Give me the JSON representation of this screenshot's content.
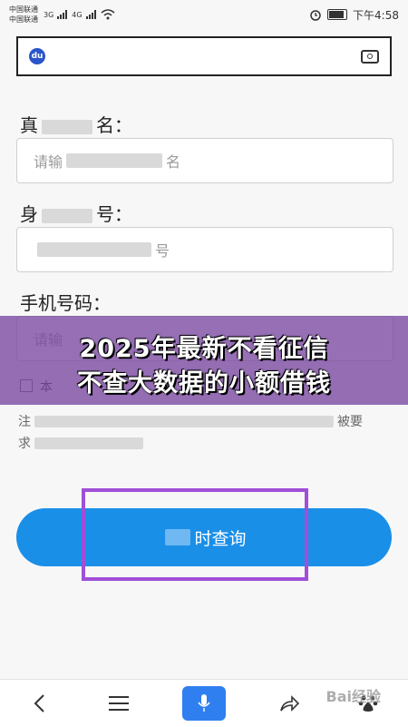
{
  "status_bar": {
    "carrier1": "中国联通",
    "carrier2": "中国联通",
    "sig1": "3G",
    "sig2": "4G",
    "time": "下午4:58"
  },
  "search": {
    "logo": "du"
  },
  "form": {
    "name_label_a": "真",
    "name_label_b": "名：",
    "name_placeholder_a": "请输",
    "name_placeholder_b": "名",
    "id_label_a": "身",
    "id_label_b": "号：",
    "id_placeholder_b": "号",
    "phone_label": "手机号码：",
    "phone_placeholder_a": "请输",
    "agree_a": "本",
    "note_a": "注",
    "note_b": "被要",
    "note_c": "求"
  },
  "overlay": {
    "line1": "2025年最新不看征信",
    "line2": "不查大数据的小额借钱"
  },
  "submit": {
    "label": "查询",
    "label_prefix": "时"
  },
  "watermark": "Bai经验",
  "icons": {
    "search_logo": "baidu-paw-icon",
    "camera": "camera-icon",
    "back": "back-icon",
    "menu": "menu-icon",
    "mic": "microphone-icon",
    "share": "share-icon",
    "home": "baidu-home-icon"
  },
  "colors": {
    "accent": "#1a8fe8",
    "overlay": "#7846a0",
    "highlight": "#a04fd8"
  }
}
